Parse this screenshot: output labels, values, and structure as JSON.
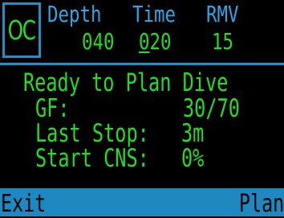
{
  "mode": {
    "label": "OC"
  },
  "header": {
    "depth_label": "Depth",
    "time_label": "Time",
    "rmv_label": "RMV",
    "depth_value": "040",
    "time_value": "020",
    "rmv_value": "15"
  },
  "body": {
    "title": "Ready to Plan Dive",
    "gf_label": "GF:",
    "gf_value": "30/70",
    "last_stop_label": "Last Stop:",
    "last_stop_value": "3m",
    "start_cns_label": "Start CNS:",
    "start_cns_value": "0%"
  },
  "footer": {
    "left_label": "Exit",
    "right_label": "Plan"
  },
  "colors": {
    "background": "#000000",
    "text_green": "#22dd22",
    "accent_blue": "#1e90c8",
    "header_blue": "#2aa8e6",
    "footer_bg": "#1e88c0"
  }
}
